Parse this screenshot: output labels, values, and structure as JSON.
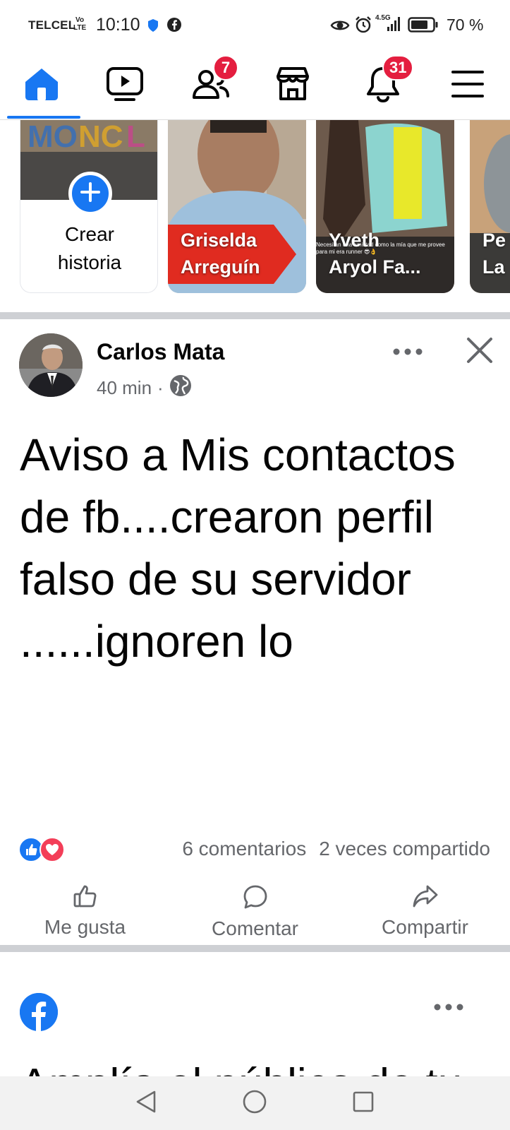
{
  "status_bar": {
    "carrier": "TELCEL",
    "volte_top": "Vo",
    "volte_bottom": "LTE",
    "time": "10:10",
    "network": "4.5G",
    "battery": "70 %"
  },
  "nav": {
    "items": [
      {
        "name": "home",
        "icon": "home-icon",
        "active": true
      },
      {
        "name": "watch",
        "icon": "video-icon"
      },
      {
        "name": "friends",
        "icon": "friends-icon",
        "badge": "7"
      },
      {
        "name": "marketplace",
        "icon": "store-icon"
      },
      {
        "name": "notifications",
        "icon": "bell-icon",
        "badge": "31"
      },
      {
        "name": "menu",
        "icon": "menu-icon"
      }
    ]
  },
  "stories": {
    "create": {
      "line1": "Crear",
      "line2": "historia"
    },
    "items": [
      {
        "line1": "Griselda",
        "line2": "Arreguín"
      },
      {
        "line1": "Yveth",
        "line2": "Aryol Fa...",
        "caption": "Necesitan una amistad como la mía que me provee para mi era runner 😎👌"
      },
      {
        "line1": "Pe",
        "line2": "La"
      }
    ]
  },
  "post": {
    "author": "Carlos Mata",
    "time": "40 min",
    "separator": "·",
    "text": "Aviso a Mis contactos de fb....crearon perfil falso de su servidor ......ignoren lo",
    "comments": "6 comentarios",
    "shares": "2 veces compartido",
    "actions": {
      "like": "Me gusta",
      "comment": "Comentar",
      "share": "Compartir"
    }
  },
  "next_post": {
    "title": "Amplía el público de tu"
  },
  "colors": {
    "brand": "#1877f2",
    "badge": "#e41e3f",
    "love": "#f33e58",
    "secondary_text": "#65676b"
  }
}
